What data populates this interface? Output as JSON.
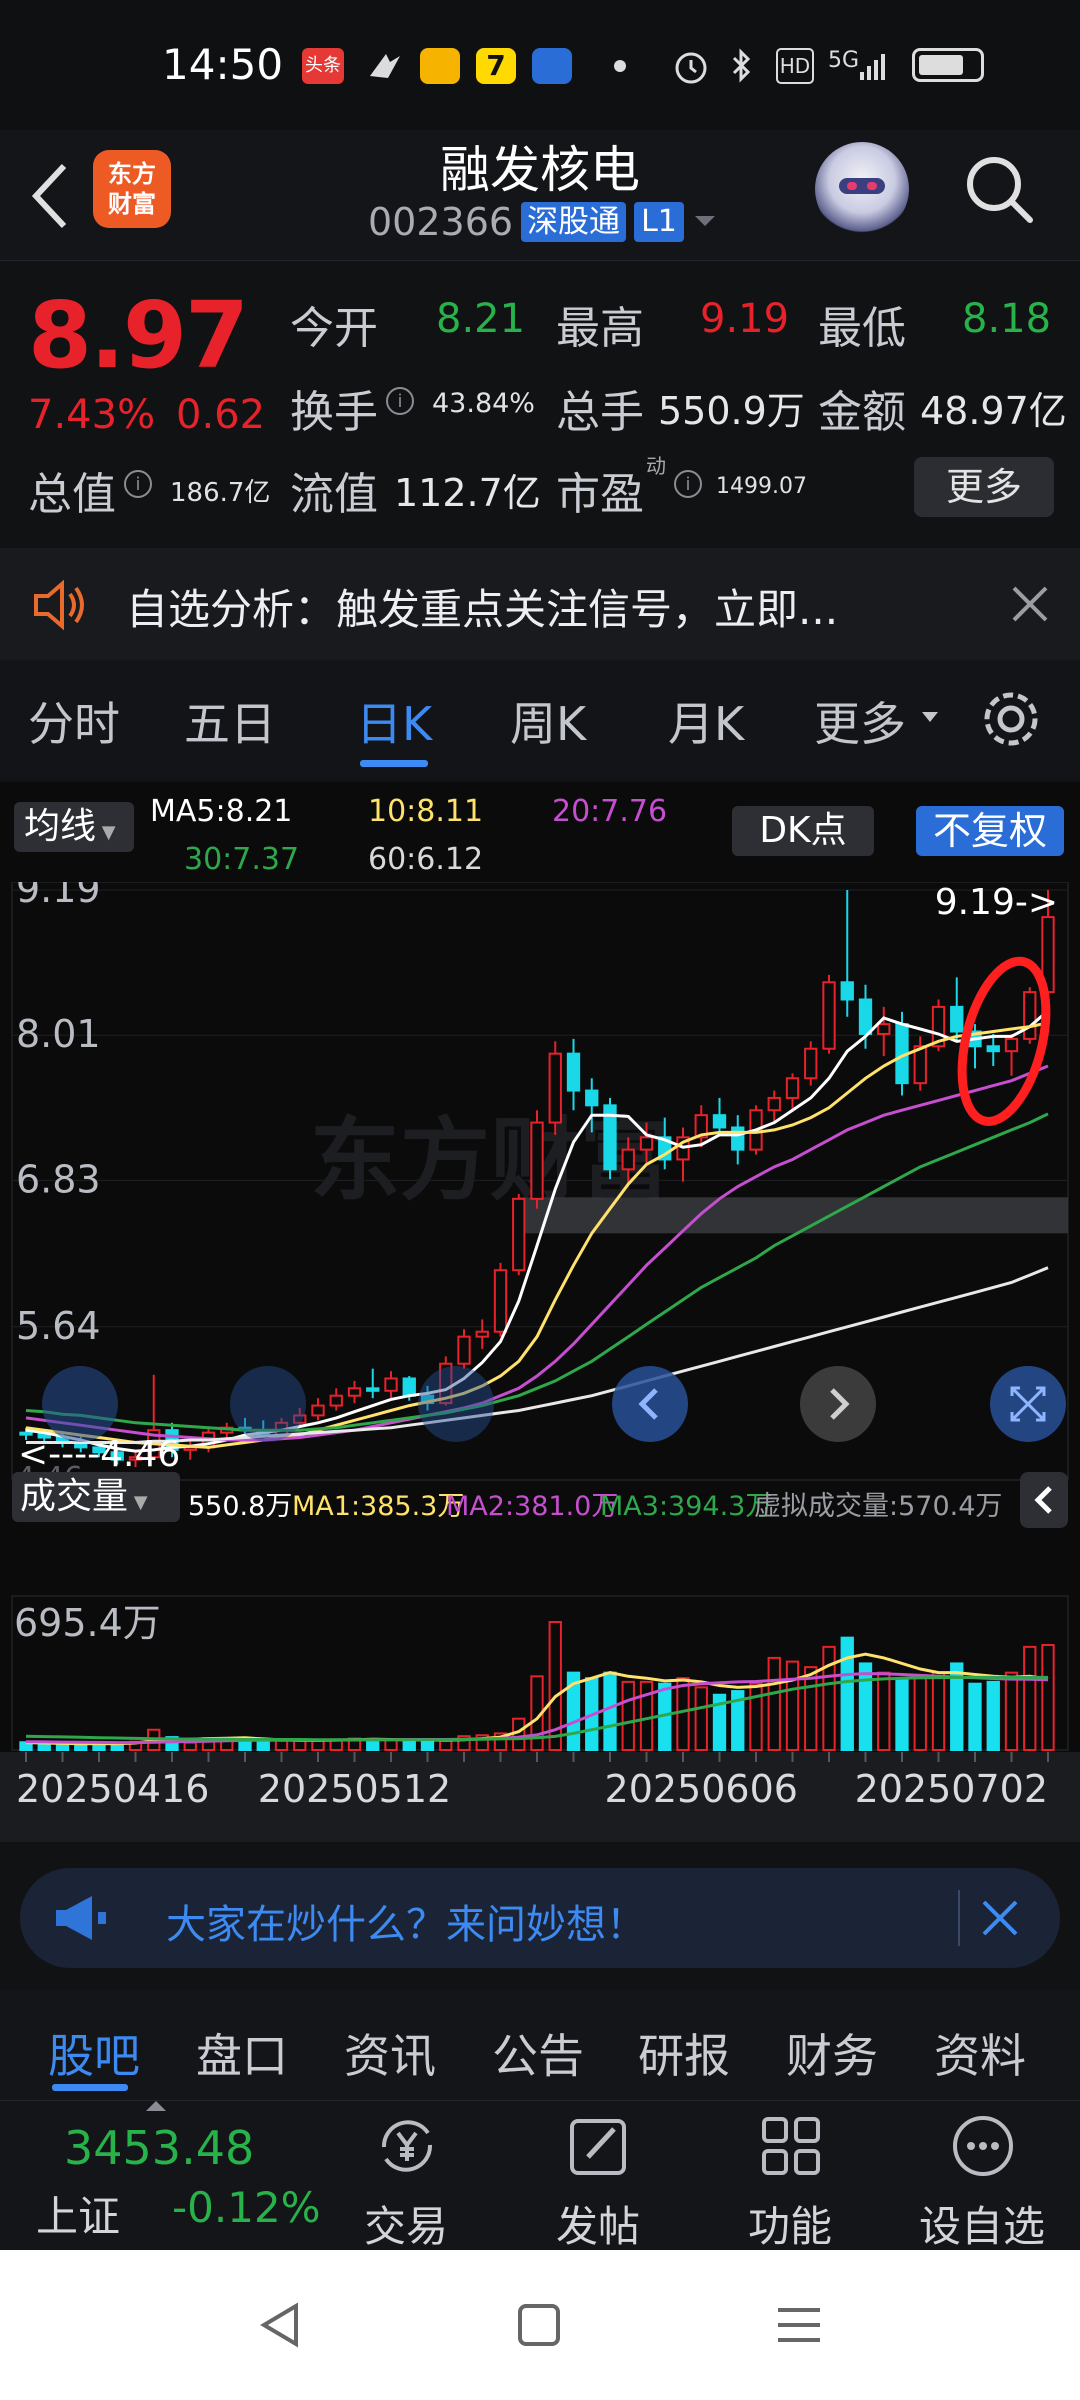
{
  "status_bar": {
    "time": "14:50",
    "icons": [
      "toutiao-app-icon",
      "feishu-app-icon",
      "mail-app-icon",
      "seven-app-icon",
      "baidu-netdisk-icon",
      "dot-icon",
      "alarm-icon",
      "bluetooth-icon",
      "hd-icon",
      "5g-signal-icon",
      "battery-icon"
    ],
    "app_badge": "头条",
    "hd": "HD",
    "net": "5G"
  },
  "header": {
    "title": "融发核电",
    "code": "002366",
    "tag": "深股通",
    "level": "L1",
    "logo_line1": "东方",
    "logo_line2": "财富"
  },
  "quote": {
    "price": "8.97",
    "change_pct": "7.43%",
    "change": "0.62",
    "open_label": "今开",
    "open": "8.21",
    "high_label": "最高",
    "high": "9.19",
    "low_label": "最低",
    "low": "8.18",
    "turnover_label": "换手",
    "turnover": "43.84%",
    "volume_label": "总手",
    "volume": "550.9万",
    "amount_label": "金额",
    "amount": "48.97亿",
    "mcap_label": "总值",
    "mcap": "186.7亿",
    "float_label": "流值",
    "float_cap": "112.7亿",
    "pe_label": "市盈",
    "pe_sup": "动",
    "pe": "1499.07",
    "more": "更多"
  },
  "notice": {
    "text": "自选分析：触发重点关注信号，立即..."
  },
  "ktabs": [
    "分时",
    "五日",
    "日K",
    "周K",
    "月K",
    "更多"
  ],
  "active_ktab": "日K",
  "chart_toolbar": {
    "avg_label": "均线",
    "ma5": "MA5:8.21",
    "ma10": "10:8.11",
    "ma20": "20:7.76",
    "ma30": "30:7.37",
    "ma60": "60:6.12",
    "dk": "DK点",
    "fq": "不复权"
  },
  "chart_data": {
    "type": "candlestick",
    "ylabels": [
      "9.19",
      "8.01",
      "6.83",
      "5.64"
    ],
    "max_marker": "9.19->",
    "min_marker": "<----4.46",
    "min_marker_sub": "4.46",
    "watermark": "东方财富",
    "candles": [
      [
        4.78,
        4.82,
        4.72,
        4.77
      ],
      [
        4.77,
        4.8,
        4.7,
        4.74
      ],
      [
        4.74,
        4.78,
        4.66,
        4.7
      ],
      [
        4.7,
        4.75,
        4.62,
        4.66
      ],
      [
        4.66,
        4.7,
        4.58,
        4.62
      ],
      [
        4.62,
        4.66,
        4.52,
        4.56
      ],
      [
        4.56,
        4.62,
        4.5,
        4.58
      ],
      [
        4.58,
        5.25,
        4.56,
        4.8
      ],
      [
        4.8,
        4.86,
        4.58,
        4.64
      ],
      [
        4.64,
        4.72,
        4.56,
        4.66
      ],
      [
        4.66,
        4.82,
        4.62,
        4.78
      ],
      [
        4.78,
        4.86,
        4.72,
        4.82
      ],
      [
        4.82,
        4.9,
        4.74,
        4.8
      ],
      [
        4.8,
        4.88,
        4.74,
        4.76
      ],
      [
        4.76,
        4.9,
        4.72,
        4.86
      ],
      [
        4.86,
        4.98,
        4.82,
        4.92
      ],
      [
        4.92,
        5.06,
        4.88,
        5.0
      ],
      [
        5.0,
        5.14,
        4.96,
        5.08
      ],
      [
        5.08,
        5.2,
        5.02,
        5.14
      ],
      [
        5.14,
        5.3,
        5.06,
        5.12
      ],
      [
        5.12,
        5.28,
        5.06,
        5.22
      ],
      [
        5.22,
        5.24,
        5.04,
        5.08
      ],
      [
        5.08,
        5.16,
        4.96,
        5.02
      ],
      [
        5.02,
        5.4,
        5.0,
        5.34
      ],
      [
        5.34,
        5.62,
        5.3,
        5.56
      ],
      [
        5.56,
        5.7,
        5.46,
        5.6
      ],
      [
        5.6,
        6.16,
        5.56,
        6.1
      ],
      [
        6.1,
        6.72,
        6.06,
        6.68
      ],
      [
        6.68,
        7.4,
        6.6,
        7.3
      ],
      [
        7.3,
        7.96,
        7.2,
        7.86
      ],
      [
        7.86,
        7.98,
        7.4,
        7.56
      ],
      [
        7.56,
        7.66,
        7.22,
        7.44
      ],
      [
        7.44,
        7.5,
        6.84,
        6.92
      ],
      [
        6.92,
        7.18,
        6.8,
        7.08
      ],
      [
        7.08,
        7.3,
        6.96,
        7.18
      ],
      [
        7.18,
        7.34,
        6.92,
        7.0
      ],
      [
        7.0,
        7.26,
        6.82,
        7.18
      ],
      [
        7.18,
        7.44,
        7.1,
        7.36
      ],
      [
        7.36,
        7.5,
        7.2,
        7.26
      ],
      [
        7.26,
        7.36,
        6.96,
        7.08
      ],
      [
        7.08,
        7.44,
        7.04,
        7.4
      ],
      [
        7.4,
        7.56,
        7.3,
        7.5
      ],
      [
        7.5,
        7.7,
        7.4,
        7.66
      ],
      [
        7.66,
        7.96,
        7.6,
        7.9
      ],
      [
        7.9,
        8.5,
        7.86,
        8.44
      ],
      [
        8.44,
        9.19,
        8.16,
        8.3
      ],
      [
        8.3,
        8.42,
        7.9,
        8.02
      ],
      [
        8.02,
        8.24,
        7.84,
        8.1
      ],
      [
        8.1,
        8.2,
        7.52,
        7.62
      ],
      [
        7.62,
        8.0,
        7.56,
        7.92
      ],
      [
        7.92,
        8.3,
        7.88,
        8.24
      ],
      [
        8.24,
        8.48,
        7.96,
        8.04
      ],
      [
        8.04,
        8.1,
        7.74,
        7.92
      ],
      [
        7.92,
        8.02,
        7.76,
        7.88
      ],
      [
        7.88,
        8.02,
        7.68,
        7.98
      ],
      [
        7.98,
        8.4,
        7.94,
        8.36
      ],
      [
        8.36,
        9.19,
        8.18,
        8.97
      ]
    ],
    "ma_series": [
      {
        "name": "MA5",
        "color": "#ffffff",
        "values": [
          4.8,
          4.78,
          4.75,
          4.72,
          4.68,
          4.65,
          4.63,
          4.64,
          4.66,
          4.67,
          4.69,
          4.72,
          4.76,
          4.78,
          4.8,
          4.83,
          4.86,
          4.9,
          4.95,
          5.0,
          5.05,
          5.08,
          5.1,
          5.13,
          5.22,
          5.35,
          5.52,
          5.85,
          6.3,
          6.76,
          7.14,
          7.36,
          7.36,
          7.35,
          7.2,
          7.16,
          7.1,
          7.12,
          7.2,
          7.2,
          7.24,
          7.3,
          7.4,
          7.5,
          7.66,
          7.88,
          8.0,
          8.15,
          8.1,
          8.06,
          8.02,
          7.96,
          7.98,
          8.0,
          8.0,
          8.08,
          8.21
        ]
      },
      {
        "name": "MA10",
        "color": "#ffe26b",
        "values": [
          4.82,
          4.8,
          4.78,
          4.76,
          4.74,
          4.72,
          4.7,
          4.69,
          4.68,
          4.67,
          4.66,
          4.68,
          4.7,
          4.72,
          4.74,
          4.76,
          4.8,
          4.84,
          4.88,
          4.92,
          4.96,
          5.0,
          5.03,
          5.06,
          5.1,
          5.16,
          5.24,
          5.36,
          5.56,
          5.86,
          6.14,
          6.4,
          6.6,
          6.8,
          6.96,
          7.04,
          7.14,
          7.2,
          7.22,
          7.22,
          7.22,
          7.24,
          7.28,
          7.34,
          7.42,
          7.54,
          7.66,
          7.76,
          7.84,
          7.9,
          7.96,
          8.0,
          8.02,
          8.04,
          8.06,
          8.08,
          8.11
        ]
      },
      {
        "name": "MA20",
        "color": "#c54fcf",
        "values": [
          4.9,
          4.88,
          4.86,
          4.84,
          4.82,
          4.8,
          4.78,
          4.76,
          4.75,
          4.74,
          4.73,
          4.72,
          4.72,
          4.72,
          4.73,
          4.74,
          4.76,
          4.78,
          4.8,
          4.83,
          4.86,
          4.89,
          4.92,
          4.95,
          4.98,
          5.02,
          5.08,
          5.14,
          5.24,
          5.36,
          5.5,
          5.66,
          5.82,
          5.98,
          6.14,
          6.28,
          6.42,
          6.56,
          6.68,
          6.78,
          6.86,
          6.94,
          7.0,
          7.08,
          7.16,
          7.24,
          7.3,
          7.36,
          7.4,
          7.44,
          7.48,
          7.52,
          7.56,
          7.6,
          7.64,
          7.7,
          7.76
        ]
      },
      {
        "name": "MA30",
        "color": "#2ea84a",
        "values": [
          4.96,
          4.95,
          4.93,
          4.92,
          4.9,
          4.88,
          4.86,
          4.85,
          4.84,
          4.83,
          4.82,
          4.81,
          4.8,
          4.8,
          4.8,
          4.8,
          4.81,
          4.82,
          4.84,
          4.86,
          4.88,
          4.9,
          4.92,
          4.94,
          4.97,
          5.0,
          5.04,
          5.08,
          5.14,
          5.2,
          5.28,
          5.36,
          5.46,
          5.56,
          5.66,
          5.76,
          5.86,
          5.96,
          6.04,
          6.12,
          6.2,
          6.3,
          6.38,
          6.46,
          6.54,
          6.62,
          6.7,
          6.78,
          6.86,
          6.94,
          7.0,
          7.06,
          7.12,
          7.18,
          7.24,
          7.3,
          7.37
        ]
      },
      {
        "name": "MA60",
        "color": "#e8e8e8",
        "values": [
          4.7,
          4.7,
          4.7,
          4.7,
          4.7,
          4.7,
          4.7,
          4.71,
          4.71,
          4.72,
          4.72,
          4.73,
          4.74,
          4.75,
          4.76,
          4.77,
          4.78,
          4.79,
          4.8,
          4.81,
          4.82,
          4.84,
          4.86,
          4.88,
          4.9,
          4.92,
          4.94,
          4.96,
          4.99,
          5.02,
          5.05,
          5.08,
          5.12,
          5.16,
          5.2,
          5.24,
          5.28,
          5.32,
          5.36,
          5.4,
          5.44,
          5.48,
          5.52,
          5.56,
          5.6,
          5.64,
          5.68,
          5.72,
          5.76,
          5.8,
          5.84,
          5.88,
          5.92,
          5.96,
          6.0,
          6.06,
          6.12
        ]
      }
    ],
    "volume_label": "成交量",
    "volume_value": "550.8万",
    "vol_ma1": "MA1:385.3万",
    "vol_ma2": "MA2:381.0万",
    "vol_ma3": "MA3:394.3万",
    "virtual_volume": "虚拟成交量:570.4万",
    "vol_max_label": "695.4万",
    "volumes": [
      42,
      30,
      36,
      22,
      40,
      30,
      45,
      110,
      70,
      40,
      65,
      52,
      60,
      45,
      50,
      55,
      50,
      55,
      62,
      60,
      55,
      58,
      48,
      50,
      75,
      80,
      90,
      170,
      400,
      695,
      420,
      390,
      420,
      370,
      370,
      360,
      390,
      340,
      300,
      320,
      360,
      500,
      480,
      450,
      560,
      610,
      470,
      420,
      380,
      390,
      420,
      470,
      360,
      370,
      420,
      560,
      570
    ],
    "vol_ma_series": [
      {
        "name": "MA1",
        "color": "#ffe26b",
        "values": [
          40,
          38,
          36,
          34,
          35,
          34,
          38,
          50,
          55,
          58,
          62,
          64,
          66,
          60,
          55,
          52,
          52,
          54,
          56,
          58,
          57,
          56,
          55,
          54,
          56,
          62,
          70,
          100,
          170,
          290,
          360,
          390,
          420,
          400,
          390,
          375,
          380,
          370,
          350,
          340,
          345,
          360,
          380,
          410,
          460,
          500,
          520,
          500,
          470,
          440,
          420,
          420,
          410,
          400,
          395,
          400,
          385
        ]
      },
      {
        "name": "MA2",
        "color": "#c54fcf",
        "values": [
          45,
          44,
          43,
          42,
          41,
          40,
          40,
          42,
          44,
          46,
          48,
          50,
          52,
          53,
          54,
          54,
          54,
          55,
          55,
          56,
          56,
          57,
          57,
          57,
          58,
          60,
          63,
          70,
          82,
          110,
          150,
          190,
          230,
          270,
          300,
          330,
          350,
          360,
          365,
          370,
          372,
          378,
          384,
          390,
          400,
          410,
          415,
          414,
          410,
          405,
          400,
          396,
          392,
          388,
          385,
          384,
          381
        ]
      },
      {
        "name": "MA3",
        "color": "#2ea84a",
        "values": [
          75,
          73,
          71,
          69,
          67,
          65,
          63,
          61,
          60,
          59,
          58,
          58,
          57,
          57,
          57,
          57,
          56,
          56,
          56,
          56,
          56,
          56,
          56,
          56,
          57,
          58,
          60,
          62,
          66,
          74,
          90,
          110,
          130,
          150,
          170,
          190,
          210,
          230,
          250,
          270,
          290,
          310,
          330,
          345,
          360,
          372,
          380,
          386,
          390,
          392,
          393,
          394,
          394,
          394,
          394,
          394,
          394
        ]
      }
    ],
    "dates": [
      "20250416",
      "20250512",
      "20250606",
      "20250702"
    ]
  },
  "banner": {
    "text": "大家在炒什么？来问妙想！"
  },
  "bottom_tabs": [
    "股吧",
    "盘口",
    "资讯",
    "公告",
    "研报",
    "财务",
    "资料"
  ],
  "active_bottom_tab": "股吧",
  "index": {
    "value": "3453.48",
    "name": "上证",
    "change": "-0.12%"
  },
  "toolbar": {
    "trade": "交易",
    "post": "发帖",
    "func": "功能",
    "watch": "设自选"
  }
}
